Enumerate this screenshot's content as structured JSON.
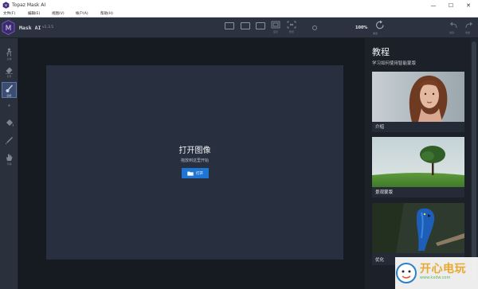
{
  "window": {
    "title": "Topaz Mask AI",
    "controls": {
      "minimize": "—",
      "maximize": "☐",
      "close": "✕"
    }
  },
  "menu": {
    "items": [
      "文件(F)",
      "编辑(E)",
      "视图(V)",
      "帐户(A)",
      "帮助(H)"
    ]
  },
  "toolbar": {
    "app_name": "Mask AI",
    "version": "v1.3.5",
    "view_labels": [
      "显示",
      "预览"
    ],
    "zoom": "100%",
    "undo_label": "撤销",
    "redo_label": "重做",
    "reset_label": "重置"
  },
  "leftbar": {
    "items": [
      {
        "name": "subject-tool",
        "label": "主体"
      },
      {
        "name": "eraser-tool",
        "label": "背景"
      },
      {
        "name": "brush-tool",
        "label": "画笔"
      },
      {
        "name": "small-tool",
        "label": ""
      },
      {
        "name": "fill-tool",
        "label": ""
      },
      {
        "name": "dropper-tool",
        "label": ""
      },
      {
        "name": "hand-tool",
        "label": "平移"
      }
    ]
  },
  "canvas": {
    "title": "打开图像",
    "subtitle": "拖放到这里开始",
    "open_label": "打开"
  },
  "tutorials": {
    "heading": "教程",
    "subheading": "学习如何使用智能蒙版",
    "cards": [
      {
        "caption": "介绍"
      },
      {
        "caption": "景观蒙版"
      },
      {
        "caption": "优化"
      }
    ]
  },
  "watermark": {
    "brand": "开心电玩",
    "url": "www.kxdw.com"
  },
  "colors": {
    "accent": "#1f75d4",
    "panel": "#283040",
    "toolbar": "#2c3240"
  }
}
